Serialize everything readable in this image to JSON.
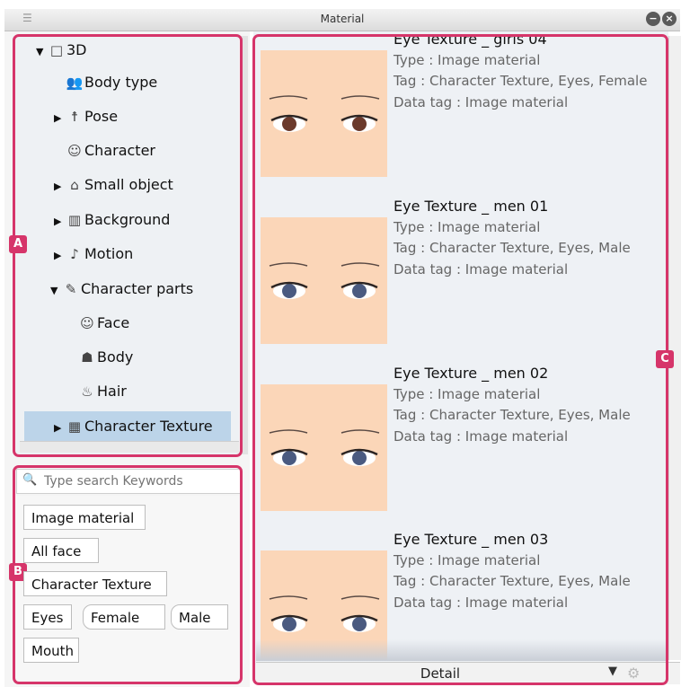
{
  "window": {
    "title": "Material"
  },
  "tree": {
    "items": [
      {
        "label": "3D",
        "arrow": "▼",
        "icon": "□"
      },
      {
        "label": "Body type",
        "arrow": "",
        "icon": "👥"
      },
      {
        "label": "Pose",
        "arrow": "▶",
        "icon": "☨"
      },
      {
        "label": "Character",
        "arrow": "",
        "icon": "☺"
      },
      {
        "label": "Small object",
        "arrow": "▶",
        "icon": "⌂"
      },
      {
        "label": "Background",
        "arrow": "▶",
        "icon": "▥"
      },
      {
        "label": "Motion",
        "arrow": "▶",
        "icon": "♪"
      },
      {
        "label": "Character parts",
        "arrow": "▼",
        "icon": "✎"
      },
      {
        "label": "Face",
        "arrow": "",
        "icon": "☺"
      },
      {
        "label": "Body",
        "arrow": "",
        "icon": "☗"
      },
      {
        "label": "Hair",
        "arrow": "",
        "icon": "♨"
      },
      {
        "label": "Character Texture",
        "arrow": "▶",
        "icon": "▦"
      }
    ]
  },
  "search": {
    "placeholder": "Type search Keywords"
  },
  "tags": [
    "Image material",
    "All face",
    "Character Texture",
    "Eyes",
    "Female",
    "Male",
    "Mouth"
  ],
  "materials": [
    {
      "title": "Eye Texture _ girls 04",
      "type": "Type : Image material",
      "tag": "Tag : Character Texture, Eyes, Female",
      "data_tag": "Data tag : Image material",
      "iris": "#6b3a2c"
    },
    {
      "title": "Eye Texture _ men 01",
      "type": "Type : Image material",
      "tag": "Tag : Character Texture, Eyes, Male",
      "data_tag": "Data tag : Image material",
      "iris": "#4a5a80"
    },
    {
      "title": "Eye Texture _ men 02",
      "type": "Type : Image material",
      "tag": "Tag : Character Texture, Eyes, Male",
      "data_tag": "Data tag : Image material",
      "iris": "#4a5a80"
    },
    {
      "title": "Eye Texture _ men 03",
      "type": "Type : Image material",
      "tag": "Tag : Character Texture, Eyes, Male",
      "data_tag": "Data tag : Image material",
      "iris": "#4a5a80"
    }
  ],
  "footer": {
    "view_mode": "Detail"
  },
  "callouts": {
    "a": "A",
    "b": "B",
    "c": "C"
  },
  "colors": {
    "callout": "#d6356a",
    "skin": "#fbd6b8",
    "selection": "#bcd4e9"
  }
}
